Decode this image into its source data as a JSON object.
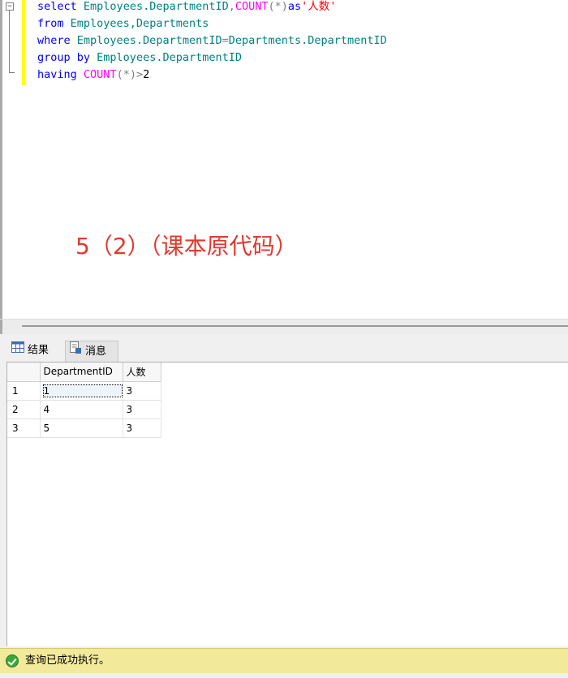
{
  "editor": {
    "collapse_glyph": "−",
    "line1": {
      "kw1": "select",
      "ident1": "Employees.DepartmentID",
      "comma": ",",
      "fn": "COUNT",
      "paren": "(*)",
      "kw2": "as",
      "str": "'人数'"
    },
    "line2": {
      "kw": "from",
      "ident": "Employees,Departments"
    },
    "line3": {
      "kw": "where",
      "ident1": "Employees.DepartmentID",
      "eq": "=",
      "ident2": "Departments.DepartmentID"
    },
    "line4": {
      "kw": "group by",
      "ident": "Employees.DepartmentID"
    },
    "line5": {
      "kw": "having",
      "fn": "COUNT",
      "paren": "(*)",
      "gt": ">",
      "num": "2"
    },
    "annotation": "5（2）（课本原代码）"
  },
  "tabs": [
    {
      "label": "结果",
      "icon": "grid-icon"
    },
    {
      "label": "消息",
      "icon": "messages-icon"
    }
  ],
  "results": {
    "columns": [
      "DepartmentID",
      "人数"
    ],
    "rows": [
      {
        "num": "1",
        "dept": "1",
        "count": "3"
      },
      {
        "num": "2",
        "dept": "4",
        "count": "3"
      },
      {
        "num": "3",
        "dept": "5",
        "count": "3"
      }
    ]
  },
  "status": {
    "text": "查询已成功执行。",
    "icon": "success-check-icon",
    "color": "#f3e99b"
  },
  "colors": {
    "keyword": "#0000ff",
    "identifier": "#008080",
    "function": "#ff00ff",
    "string": "#ff0000",
    "annotation": "#e03a2e"
  }
}
